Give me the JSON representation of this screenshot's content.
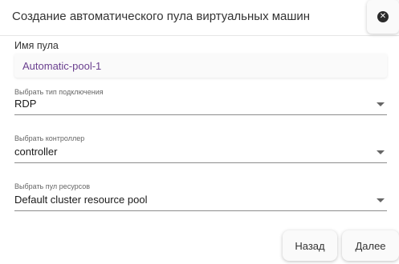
{
  "dialog": {
    "title": "Создание автоматического пула виртуальных машин",
    "close_icon": "close-circle-icon"
  },
  "form": {
    "pool_name": {
      "label": "Имя пула",
      "value": "Automatic-pool-1"
    },
    "connection_type": {
      "label": "Выбрать тип подключения",
      "value": "RDP"
    },
    "controller": {
      "label": "Выбрать контроллер",
      "value": "controller"
    },
    "resource_pool": {
      "label": "Выбрать пул ресурсов",
      "value": "Default cluster resource pool"
    }
  },
  "footer": {
    "back_label": "Назад",
    "next_label": "Далее"
  },
  "colors": {
    "input_text": "#6a3f8f",
    "underline": "#8c8c8c"
  }
}
